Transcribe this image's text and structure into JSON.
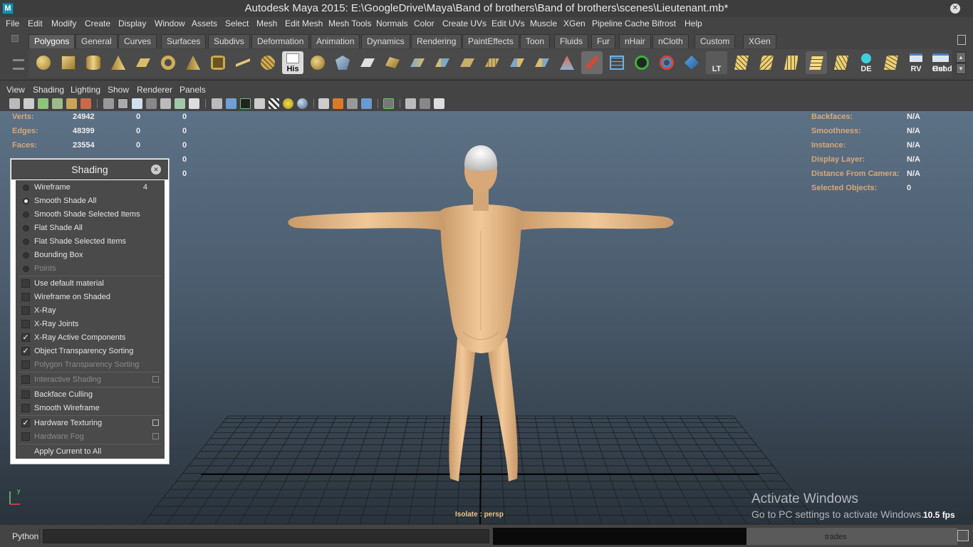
{
  "window": {
    "app_icon_letter": "M",
    "title": "Autodesk Maya 2015: E:\\GoogleDrive\\Maya\\Band of brothers\\Band of brothers\\scenes\\Lieutenant.mb*",
    "close_glyph": "✕"
  },
  "menubar": {
    "items": [
      "File",
      "Edit",
      "Modify",
      "Create",
      "Display",
      "Window",
      "Assets",
      "Select",
      "Mesh",
      "Edit Mesh",
      "Mesh Tools",
      "Normals",
      "Color",
      "Create UVs",
      "Edit UVs",
      "Muscle",
      "XGen",
      "Pipeline Cache",
      "Bifrost",
      "Help"
    ]
  },
  "shelf": {
    "tabs": [
      "Polygons",
      "General",
      "Curves",
      "Surfaces",
      "Subdivs",
      "Deformation",
      "Animation",
      "Dynamics",
      "Rendering",
      "PaintEffects",
      "Toon",
      "Fluids",
      "Fur",
      "nHair",
      "nCloth",
      "Custom",
      "XGen"
    ],
    "active_tab": "Polygons",
    "labeled_tools": {
      "his": "His",
      "lt": "LT",
      "de": "DE",
      "rv": "RV",
      "hshd": "Hshd",
      "out": "Out"
    },
    "scroll_up": "▲",
    "scroll_down": "▼"
  },
  "viewport_menu": {
    "items": [
      "View",
      "Shading",
      "Lighting",
      "Show",
      "Renderer",
      "Panels"
    ]
  },
  "hud_left": {
    "rows": [
      {
        "label": "Verts:",
        "v1": "24942",
        "v2": "0",
        "v3": "0"
      },
      {
        "label": "Edges:",
        "v1": "48399",
        "v2": "0",
        "v3": "0"
      },
      {
        "label": "Faces:",
        "v1": "23554",
        "v2": "0",
        "v3": "0"
      },
      {
        "label": "",
        "v1": "",
        "v2": "",
        "v3": "0"
      },
      {
        "label": "",
        "v1": "",
        "v2": "",
        "v3": "0"
      }
    ]
  },
  "hud_right": {
    "rows": [
      {
        "label": "Backfaces:",
        "value": "N/A"
      },
      {
        "label": "Smoothness:",
        "value": "N/A"
      },
      {
        "label": "Instance:",
        "value": "N/A"
      },
      {
        "label": "Display Layer:",
        "value": "N/A"
      },
      {
        "label": "Distance From Camera:",
        "value": "N/A"
      },
      {
        "label": "Selected Objects:",
        "value": "0"
      }
    ]
  },
  "shading_panel": {
    "title": "Shading",
    "close_glyph": "✕",
    "wireframe_shortcut": "4",
    "items": {
      "wireframe": "Wireframe",
      "smooth_shade_all": "Smooth Shade All",
      "smooth_shade_selected": "Smooth Shade Selected Items",
      "flat_shade_all": "Flat Shade All",
      "flat_shade_selected": "Flat Shade Selected Items",
      "bounding_box": "Bounding Box",
      "points": "Points",
      "use_default_material": "Use default material",
      "wireframe_on_shaded": "Wireframe on Shaded",
      "xray": "X-Ray",
      "xray_joints": "X-Ray Joints",
      "xray_active": "X-Ray Active Components",
      "object_transparency": "Object Transparency Sorting",
      "polygon_transparency": "Polygon Transparency Sorting",
      "interactive_shading": "Interactive Shading",
      "backface_culling": "Backface Culling",
      "smooth_wireframe": "Smooth Wireframe",
      "hardware_texturing": "Hardware Texturing",
      "hardware_fog": "Hardware Fog",
      "apply_current": "Apply Current to All"
    },
    "check_glyph": "✓"
  },
  "viewport": {
    "axis_y": "y",
    "isolate": "Isolate : persp",
    "activate_title": "Activate Windows",
    "activate_sub": "Go to PC settings to activate Windows.",
    "fps": "10.5 fps"
  },
  "command_line": {
    "language": "Python",
    "input_value": "",
    "result_text": "trades"
  }
}
